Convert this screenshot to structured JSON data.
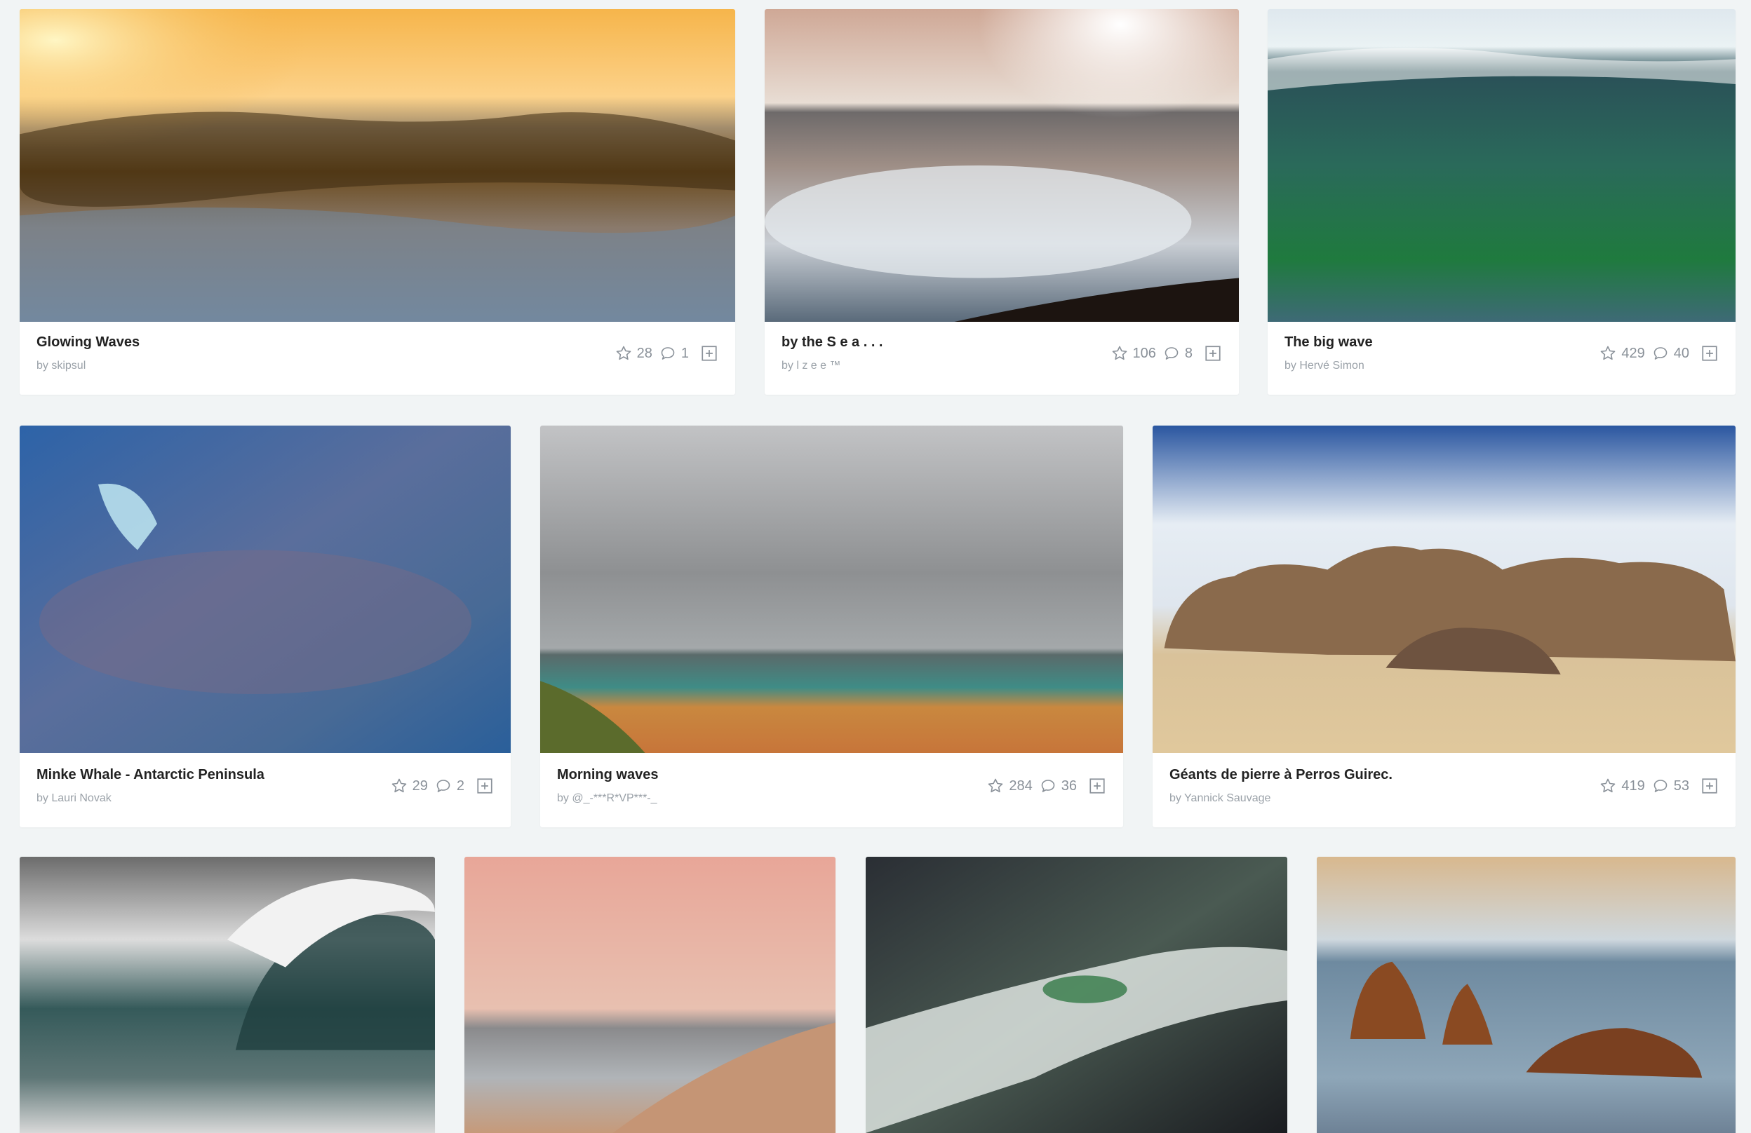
{
  "photos": [
    {
      "title": "Glowing Waves",
      "author": "by skipsul",
      "likes": "28",
      "comments": "1"
    },
    {
      "title": "by the S e a . . .",
      "author": "by l z e e ™",
      "likes": "106",
      "comments": "8"
    },
    {
      "title": "The big wave",
      "author": "by Hervé Simon",
      "likes": "429",
      "comments": "40"
    },
    {
      "title": "Minke Whale - Antarctic Peninsula",
      "author": "by Lauri Novak",
      "likes": "29",
      "comments": "2"
    },
    {
      "title": "Morning waves",
      "author": "by @_-***R*VP***-_",
      "likes": "284",
      "comments": "36"
    },
    {
      "title": "Géants de pierre à Perros Guirec.",
      "author": "by Yannick Sauvage",
      "likes": "419",
      "comments": "53"
    }
  ],
  "icons": {
    "like": "star-icon",
    "comment": "comment-icon",
    "add": "add-to-gallery-icon"
  },
  "colors": {
    "background": "#f1f4f5",
    "card": "#ffffff",
    "title": "#222222",
    "muted": "#8a9199"
  }
}
